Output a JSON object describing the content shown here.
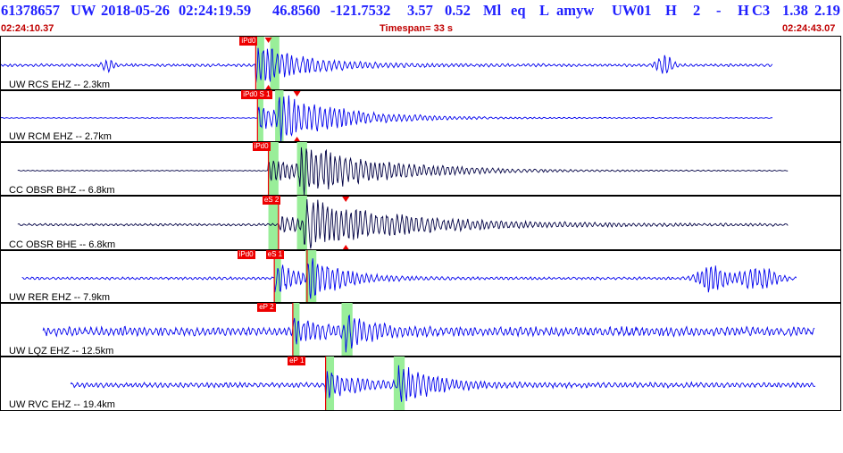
{
  "header": {
    "event_id": "61378657",
    "network": "UW",
    "origin_date": "2018-05-26",
    "origin_time": "02:24:19.59",
    "latitude": "46.8560",
    "longitude": "-121.7532",
    "depth": "3.57",
    "magnitude": "0.52",
    "magnitude_type": "Ml",
    "event_type": "eq",
    "gtype": "L",
    "author": "amyw",
    "source": "UW",
    "version": "01",
    "quality": "H",
    "phases": "2",
    "dash": "-",
    "review": "H",
    "c3": "C3",
    "val1": "1.38",
    "val2": "2.19",
    "start_time": "02:24:10.37",
    "timespan_label": "Timespan=  33 s",
    "end_time": "02:24:43.07"
  },
  "colors": {
    "title": "#2020ff",
    "subtitle": "#c00000",
    "trace_primary": "#0000ee",
    "trace_secondary": "#000044",
    "pick": "#ee0000",
    "window": "#99ee99"
  },
  "panels": [
    {
      "label": "UW RCS EHZ -- 2.3km",
      "color": "#0000ee",
      "seed": 3,
      "noise": 0.05,
      "trace_start": 0.0,
      "trace_end": 0.918,
      "windows": [
        [
          0.304,
          0.313
        ],
        [
          0.32,
          0.331
        ]
      ],
      "picks": [
        {
          "label": "iPd0",
          "t": 0.303,
          "tick_at": 0.303
        },
        {
          "label": "",
          "t": 0.318,
          "marker": "triangle-down"
        }
      ],
      "events": [
        {
          "t": 0.303,
          "amp": 0.85,
          "decay": 0.06,
          "freq": 1.0
        }
      ],
      "bursts": [
        {
          "t": 0.128,
          "amp": 0.22,
          "width": 0.008
        },
        {
          "t": 0.789,
          "amp": 0.4,
          "width": 0.01
        }
      ]
    },
    {
      "label": "UW RCM EHZ -- 2.7km",
      "color": "#0000ee",
      "seed": 7,
      "noise": 0.015,
      "trace_start": 0.0,
      "trace_end": 0.918,
      "windows": [
        [
          0.305,
          0.312
        ],
        [
          0.326,
          0.336
        ]
      ],
      "picks": [
        {
          "label": "iPd0 S 1",
          "t": 0.305,
          "tick_at": 0.305
        },
        {
          "label": "",
          "t": 0.352,
          "marker": "triangle-down"
        }
      ],
      "events": [
        {
          "t": 0.305,
          "amp": 0.55,
          "decay": 0.05,
          "freq": 0.8
        },
        {
          "t": 0.33,
          "amp": 0.8,
          "decay": 0.08,
          "freq": 0.7
        }
      ],
      "bursts": []
    },
    {
      "label": "CC OBSR BHZ -- 6.8km",
      "color": "#000044",
      "seed": 11,
      "noise": 0.015,
      "trace_start": 0.02,
      "trace_end": 0.936,
      "windows": [
        [
          0.318,
          0.33
        ],
        [
          0.352,
          0.364
        ]
      ],
      "picks": [
        {
          "label": "iPd0",
          "t": 0.318,
          "tick_at": 0.318
        }
      ],
      "events": [
        {
          "t": 0.318,
          "amp": 0.5,
          "decay": 0.07,
          "freq": 0.8
        },
        {
          "t": 0.355,
          "amp": 0.85,
          "decay": 0.1,
          "freq": 0.6
        }
      ],
      "bursts": []
    },
    {
      "label": "CC OBSR BHE -- 6.8km",
      "color": "#000044",
      "seed": 17,
      "noise": 0.04,
      "trace_start": 0.02,
      "trace_end": 0.936,
      "windows": [
        [
          0.318,
          0.33
        ],
        [
          0.352,
          0.364
        ]
      ],
      "picks": [
        {
          "label": "eS 2",
          "t": 0.33,
          "tick_at": 0.33
        },
        {
          "label": "",
          "t": 0.41,
          "marker": "triangle-down"
        }
      ],
      "events": [
        {
          "t": 0.33,
          "amp": 0.35,
          "decay": 0.05,
          "freq": 0.8
        },
        {
          "t": 0.36,
          "amp": 0.9,
          "decay": 0.12,
          "freq": 0.55
        }
      ],
      "bursts": []
    },
    {
      "label": "UW RER EHZ -- 7.9km",
      "color": "#0000ee",
      "seed": 23,
      "noise": 0.05,
      "trace_start": 0.025,
      "trace_end": 0.946,
      "windows": [
        [
          0.325,
          0.333
        ],
        [
          0.362,
          0.375
        ]
      ],
      "picks": [
        {
          "label": "iPd0",
          "t": 0.3,
          "tick_at": 0.325
        },
        {
          "label": "eS 1",
          "t": 0.334,
          "tick_at": 0.364
        }
      ],
      "events": [
        {
          "t": 0.325,
          "amp": 0.7,
          "decay": 0.03,
          "freq": 1.0
        },
        {
          "t": 0.364,
          "amp": 0.85,
          "decay": 0.04,
          "freq": 0.9
        }
      ],
      "bursts": [
        {
          "t": 0.845,
          "amp": 0.55,
          "width": 0.018
        },
        {
          "t": 0.9,
          "amp": 0.45,
          "width": 0.025
        }
      ]
    },
    {
      "label": "UW LQZ EHZ -- 12.5km",
      "color": "#0000ee",
      "seed": 31,
      "noise": 0.16,
      "trace_start": 0.05,
      "trace_end": 0.968,
      "windows": [
        [
          0.347,
          0.355
        ],
        [
          0.405,
          0.418
        ]
      ],
      "picks": [
        {
          "label": "eP 2",
          "t": 0.324,
          "tick_at": 0.347
        }
      ],
      "events": [
        {
          "t": 0.347,
          "amp": 0.55,
          "decay": 0.03,
          "freq": 0.9
        },
        {
          "t": 0.41,
          "amp": 0.6,
          "decay": 0.03,
          "freq": 0.9
        }
      ],
      "bursts": []
    },
    {
      "label": "UW RVC EHZ -- 19.4km",
      "color": "#0000ee",
      "seed": 41,
      "noise": 0.09,
      "trace_start": 0.083,
      "trace_end": 0.968,
      "windows": [
        [
          0.386,
          0.396
        ],
        [
          0.467,
          0.48
        ]
      ],
      "picks": [
        {
          "label": "eP 1",
          "t": 0.36,
          "tick_at": 0.386
        }
      ],
      "events": [
        {
          "t": 0.386,
          "amp": 0.6,
          "decay": 0.04,
          "freq": 0.8
        },
        {
          "t": 0.472,
          "amp": 0.75,
          "decay": 0.04,
          "freq": 0.8
        }
      ],
      "bursts": []
    }
  ]
}
